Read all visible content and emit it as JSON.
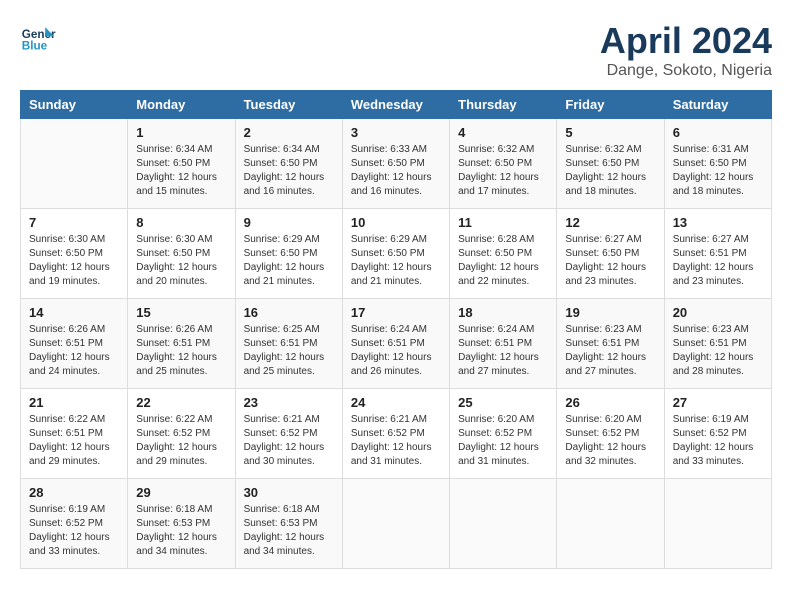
{
  "header": {
    "logo_line1": "General",
    "logo_line2": "Blue",
    "title": "April 2024",
    "subtitle": "Dange, Sokoto, Nigeria"
  },
  "weekdays": [
    "Sunday",
    "Monday",
    "Tuesday",
    "Wednesday",
    "Thursday",
    "Friday",
    "Saturday"
  ],
  "weeks": [
    [
      {
        "day": "",
        "info": ""
      },
      {
        "day": "1",
        "info": "Sunrise: 6:34 AM\nSunset: 6:50 PM\nDaylight: 12 hours\nand 15 minutes."
      },
      {
        "day": "2",
        "info": "Sunrise: 6:34 AM\nSunset: 6:50 PM\nDaylight: 12 hours\nand 16 minutes."
      },
      {
        "day": "3",
        "info": "Sunrise: 6:33 AM\nSunset: 6:50 PM\nDaylight: 12 hours\nand 16 minutes."
      },
      {
        "day": "4",
        "info": "Sunrise: 6:32 AM\nSunset: 6:50 PM\nDaylight: 12 hours\nand 17 minutes."
      },
      {
        "day": "5",
        "info": "Sunrise: 6:32 AM\nSunset: 6:50 PM\nDaylight: 12 hours\nand 18 minutes."
      },
      {
        "day": "6",
        "info": "Sunrise: 6:31 AM\nSunset: 6:50 PM\nDaylight: 12 hours\nand 18 minutes."
      }
    ],
    [
      {
        "day": "7",
        "info": "Sunrise: 6:30 AM\nSunset: 6:50 PM\nDaylight: 12 hours\nand 19 minutes."
      },
      {
        "day": "8",
        "info": "Sunrise: 6:30 AM\nSunset: 6:50 PM\nDaylight: 12 hours\nand 20 minutes."
      },
      {
        "day": "9",
        "info": "Sunrise: 6:29 AM\nSunset: 6:50 PM\nDaylight: 12 hours\nand 21 minutes."
      },
      {
        "day": "10",
        "info": "Sunrise: 6:29 AM\nSunset: 6:50 PM\nDaylight: 12 hours\nand 21 minutes."
      },
      {
        "day": "11",
        "info": "Sunrise: 6:28 AM\nSunset: 6:50 PM\nDaylight: 12 hours\nand 22 minutes."
      },
      {
        "day": "12",
        "info": "Sunrise: 6:27 AM\nSunset: 6:50 PM\nDaylight: 12 hours\nand 23 minutes."
      },
      {
        "day": "13",
        "info": "Sunrise: 6:27 AM\nSunset: 6:51 PM\nDaylight: 12 hours\nand 23 minutes."
      }
    ],
    [
      {
        "day": "14",
        "info": "Sunrise: 6:26 AM\nSunset: 6:51 PM\nDaylight: 12 hours\nand 24 minutes."
      },
      {
        "day": "15",
        "info": "Sunrise: 6:26 AM\nSunset: 6:51 PM\nDaylight: 12 hours\nand 25 minutes."
      },
      {
        "day": "16",
        "info": "Sunrise: 6:25 AM\nSunset: 6:51 PM\nDaylight: 12 hours\nand 25 minutes."
      },
      {
        "day": "17",
        "info": "Sunrise: 6:24 AM\nSunset: 6:51 PM\nDaylight: 12 hours\nand 26 minutes."
      },
      {
        "day": "18",
        "info": "Sunrise: 6:24 AM\nSunset: 6:51 PM\nDaylight: 12 hours\nand 27 minutes."
      },
      {
        "day": "19",
        "info": "Sunrise: 6:23 AM\nSunset: 6:51 PM\nDaylight: 12 hours\nand 27 minutes."
      },
      {
        "day": "20",
        "info": "Sunrise: 6:23 AM\nSunset: 6:51 PM\nDaylight: 12 hours\nand 28 minutes."
      }
    ],
    [
      {
        "day": "21",
        "info": "Sunrise: 6:22 AM\nSunset: 6:51 PM\nDaylight: 12 hours\nand 29 minutes."
      },
      {
        "day": "22",
        "info": "Sunrise: 6:22 AM\nSunset: 6:52 PM\nDaylight: 12 hours\nand 29 minutes."
      },
      {
        "day": "23",
        "info": "Sunrise: 6:21 AM\nSunset: 6:52 PM\nDaylight: 12 hours\nand 30 minutes."
      },
      {
        "day": "24",
        "info": "Sunrise: 6:21 AM\nSunset: 6:52 PM\nDaylight: 12 hours\nand 31 minutes."
      },
      {
        "day": "25",
        "info": "Sunrise: 6:20 AM\nSunset: 6:52 PM\nDaylight: 12 hours\nand 31 minutes."
      },
      {
        "day": "26",
        "info": "Sunrise: 6:20 AM\nSunset: 6:52 PM\nDaylight: 12 hours\nand 32 minutes."
      },
      {
        "day": "27",
        "info": "Sunrise: 6:19 AM\nSunset: 6:52 PM\nDaylight: 12 hours\nand 33 minutes."
      }
    ],
    [
      {
        "day": "28",
        "info": "Sunrise: 6:19 AM\nSunset: 6:52 PM\nDaylight: 12 hours\nand 33 minutes."
      },
      {
        "day": "29",
        "info": "Sunrise: 6:18 AM\nSunset: 6:53 PM\nDaylight: 12 hours\nand 34 minutes."
      },
      {
        "day": "30",
        "info": "Sunrise: 6:18 AM\nSunset: 6:53 PM\nDaylight: 12 hours\nand 34 minutes."
      },
      {
        "day": "",
        "info": ""
      },
      {
        "day": "",
        "info": ""
      },
      {
        "day": "",
        "info": ""
      },
      {
        "day": "",
        "info": ""
      }
    ]
  ]
}
